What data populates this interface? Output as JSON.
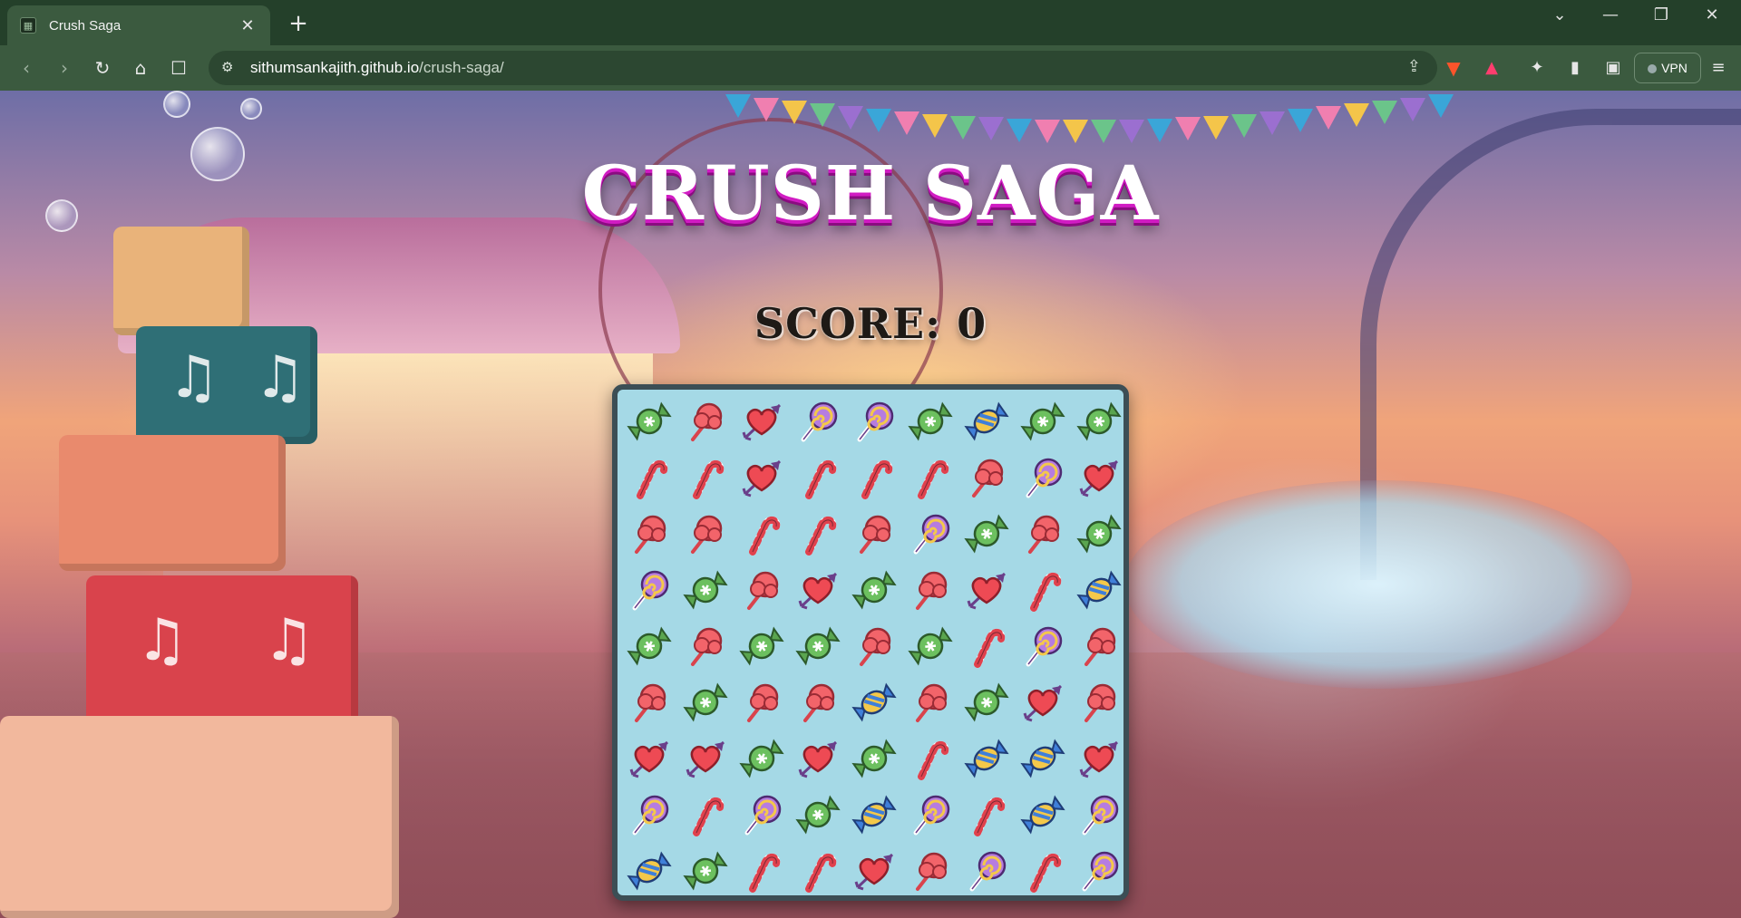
{
  "browser": {
    "tab": {
      "title": "Crush Saga",
      "close_glyph": "✕",
      "favicon": "crush-saga-favicon"
    },
    "new_tab_glyph": "+",
    "window_controls": {
      "tabs_menu": "⌄",
      "minimize": "—",
      "restore": "❐",
      "close": "✕"
    },
    "toolbar": {
      "back": "‹",
      "forward": "›",
      "reload": "↻",
      "home": "⌂",
      "bookmark": "☐",
      "site_info_icon": "⚙",
      "url_host": "sithumsankajith.github.io",
      "url_path": "/crush-saga/",
      "share_glyph": "⇪",
      "extensions_glyph": "✦",
      "sidebar_glyph": "▮",
      "wallet_glyph": "▣",
      "vpn_label": "VPN",
      "menu_glyph": "≡"
    }
  },
  "game": {
    "title": "CRUSH SAGA",
    "score_text": "SCORE: 0",
    "score": 0,
    "colors": {
      "title_fill": "#ffffff",
      "title_shadow": "#d11cc3",
      "board_bg": "#a5d9e6",
      "board_border": "#3c4e55"
    },
    "board": {
      "rows": 9,
      "cols": 9,
      "legend": {
        "G": "green-wrapped-candy",
        "C": "cotton-candy",
        "H": "heart-arrow",
        "L": "swirl-lollipop",
        "B": "blue-wrapped-candy",
        "K": "candy-cane"
      },
      "grid": [
        [
          "G",
          "C",
          "H",
          "L",
          "L",
          "G",
          "B",
          "G",
          "G"
        ],
        [
          "K",
          "K",
          "H",
          "K",
          "K",
          "K",
          "C",
          "L",
          "H"
        ],
        [
          "C",
          "C",
          "K",
          "K",
          "C",
          "L",
          "G",
          "C",
          "G"
        ],
        [
          "L",
          "G",
          "C",
          "H",
          "G",
          "C",
          "H",
          "K",
          "B"
        ],
        [
          "G",
          "C",
          "G",
          "G",
          "C",
          "G",
          "K",
          "L",
          "C"
        ],
        [
          "C",
          "G",
          "C",
          "C",
          "B",
          "C",
          "G",
          "H",
          "C"
        ],
        [
          "H",
          "H",
          "G",
          "H",
          "G",
          "K",
          "B",
          "B",
          "H"
        ],
        [
          "L",
          "K",
          "L",
          "G",
          "B",
          "L",
          "K",
          "B",
          "L"
        ],
        [
          "B",
          "G",
          "K",
          "K",
          "H",
          "C",
          "L",
          "K",
          "L"
        ]
      ]
    }
  }
}
